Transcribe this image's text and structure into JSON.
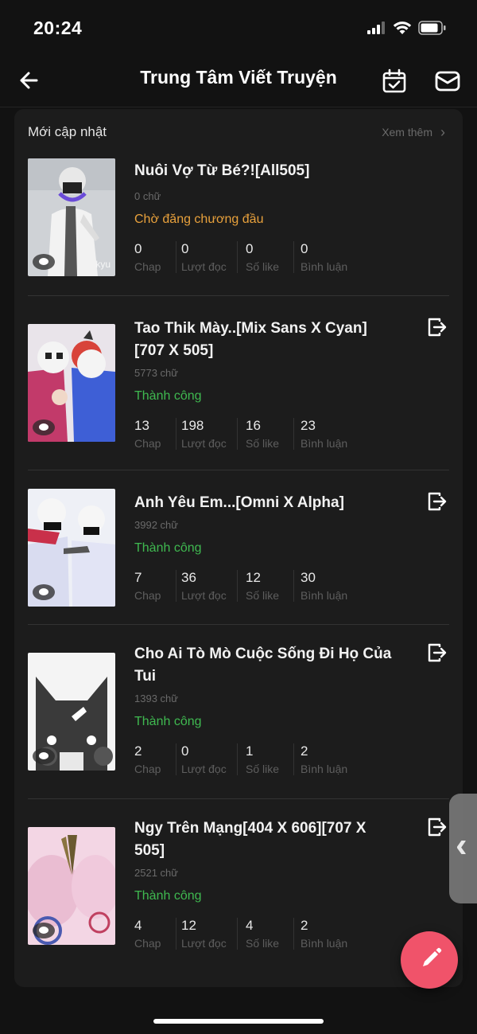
{
  "status_bar": {
    "time": "20:24"
  },
  "header": {
    "title": "Trung Tâm Viết Truyện"
  },
  "section": {
    "title": "Mới cập nhật",
    "see_more": "Xem thêm"
  },
  "stat_labels": {
    "chap": "Chap",
    "reads": "Lượt đọc",
    "likes": "Số like",
    "comments": "Bình luận"
  },
  "colors": {
    "pending": "#e8a13c",
    "success": "#3fb950",
    "fab": "#f0536a"
  },
  "stories": [
    {
      "title": "Nuôi Vợ Từ Bé?![All505]",
      "words": "0 chữ",
      "status": "Chờ đăng chương đầu",
      "status_type": "pending",
      "chap": "0",
      "reads": "0",
      "likes": "0",
      "comments": "0",
      "thumb_watermark": "kyu"
    },
    {
      "title": "Tao Thik Mày..[Mix Sans X Cyan][707 X 505]",
      "words": "5773 chữ",
      "status": "Thành công",
      "status_type": "success",
      "chap": "13",
      "reads": "198",
      "likes": "16",
      "comments": "23"
    },
    {
      "title": "Anh Yêu Em...[Omni X Alpha]",
      "words": "3992 chữ",
      "status": "Thành công",
      "status_type": "success",
      "chap": "7",
      "reads": "36",
      "likes": "12",
      "comments": "30"
    },
    {
      "title": "Cho Ai Tò Mò Cuộc Sống Đi Họ Của Tui",
      "words": "1393 chữ",
      "status": "Thành công",
      "status_type": "success",
      "chap": "2",
      "reads": "0",
      "likes": "1",
      "comments": "2"
    },
    {
      "title": "Ngy Trên Mạng[404 X 606][707 X 505]",
      "words": "2521 chữ",
      "status": "Thành công",
      "status_type": "success",
      "chap": "4",
      "reads": "12",
      "likes": "4",
      "comments": "2"
    }
  ]
}
